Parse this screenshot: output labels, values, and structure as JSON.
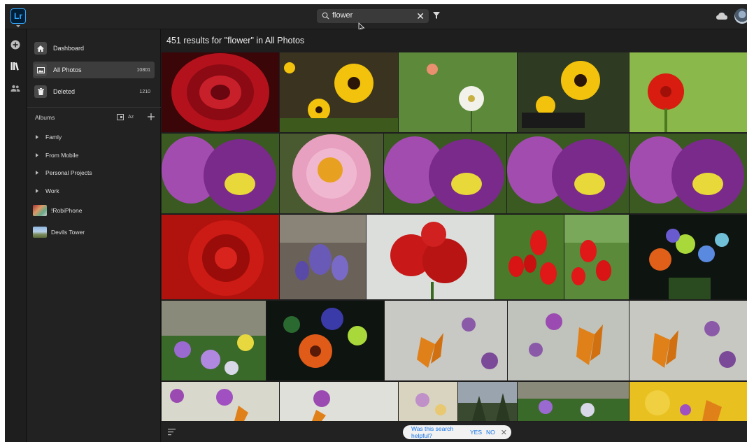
{
  "app": {
    "logo_text": "Lr",
    "accent_color": "#31a8ff"
  },
  "search": {
    "value": "flower",
    "icons": [
      "search-icon",
      "clear-icon",
      "filter-icon"
    ]
  },
  "sidebar": {
    "nav": [
      {
        "label": "Dashboard",
        "icon": "home-icon"
      },
      {
        "label": "All Photos",
        "count": "10801",
        "icon": "photo-icon",
        "active": true
      },
      {
        "label": "Deleted",
        "count": "1210",
        "icon": "trash-icon"
      }
    ],
    "albums_title": "Albums",
    "albums_sort_label": "Az",
    "folders": [
      {
        "label": "Famly"
      },
      {
        "label": "From Mobile"
      },
      {
        "label": "Personal Projects"
      },
      {
        "label": "Work"
      }
    ],
    "albums": [
      {
        "label": "!RobiPhone"
      },
      {
        "label": "Devils Tower"
      }
    ]
  },
  "main": {
    "results_title": "451 results for \"flower\" in All Photos"
  },
  "feedback": {
    "question": "Was this search helpful?",
    "yes_label": "YES",
    "no_label": "NO",
    "close_label": "✕"
  },
  "photos": [
    {
      "subject": "red rose"
    },
    {
      "subject": "black-eyed susans"
    },
    {
      "subject": "white zinnia"
    },
    {
      "subject": "black-eyed susans"
    },
    {
      "subject": "red zinnia"
    },
    {
      "subject": "purple tulips"
    },
    {
      "subject": "pink peony"
    },
    {
      "subject": "purple tulips"
    },
    {
      "subject": "purple tulips"
    },
    {
      "subject": "purple tulips"
    },
    {
      "subject": "red rose"
    },
    {
      "subject": "purple crocus"
    },
    {
      "subject": "red roses"
    },
    {
      "subject": "red tulips"
    },
    {
      "subject": "red tulips"
    },
    {
      "subject": "bouquet"
    },
    {
      "subject": "greenhouse flowers"
    },
    {
      "subject": "gerbera bouquet"
    },
    {
      "subject": "monarch butterfly"
    },
    {
      "subject": "monarch butterfly"
    },
    {
      "subject": "monarch butterfly"
    },
    {
      "subject": "purple wildflowers"
    },
    {
      "subject": "purple wildflowers"
    },
    {
      "subject": "wildflowers"
    },
    {
      "subject": "trees"
    },
    {
      "subject": "greenhouse flowers"
    },
    {
      "subject": "yellow butterfly"
    }
  ]
}
